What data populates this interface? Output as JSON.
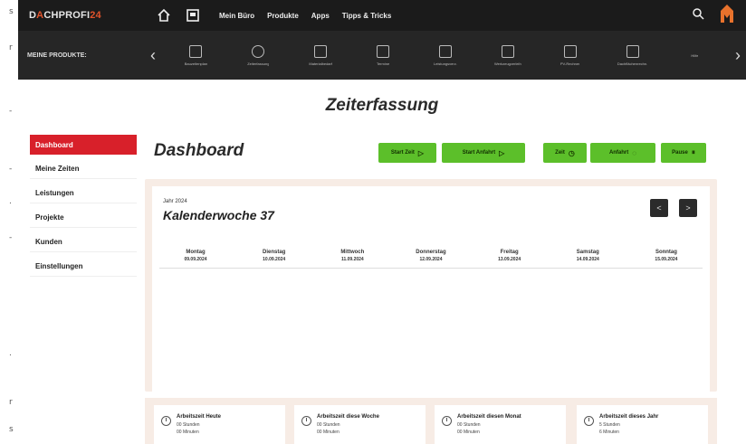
{
  "header": {
    "logo_prefix": "D",
    "logo_accent": "A",
    "logo_rest": "CHPROFI",
    "logo_suffix": "24",
    "nav": [
      "Mein Büro",
      "Produkte",
      "Apps",
      "Tipps & Tricks"
    ]
  },
  "products_bar": {
    "label": "MEINE PRODUKTE:",
    "items": [
      "Bauzeitenplan",
      "Zeiterfassung",
      "Materialbedarf",
      "Termine",
      "Leistungsverz.",
      "Werkzeugverleih",
      "PV-Rechner",
      "Dachflächenrechn.",
      "Hilfe"
    ]
  },
  "page": {
    "title": "Zeiterfassung"
  },
  "sidebar": {
    "items": [
      "Dashboard",
      "Meine Zeiten",
      "Leistungen",
      "Projekte",
      "Kunden",
      "Einstellungen"
    ]
  },
  "dashboard": {
    "title": "Dashboard",
    "buttons": {
      "start_time": "Start Zeit",
      "start_travel": "Start Anfahrt",
      "time": "Zeit",
      "travel": "Anfahrt",
      "pause": "Pause"
    }
  },
  "calendar": {
    "year_label": "Jahr 2024",
    "week_label": "Kalenderwoche 37",
    "prev": "<",
    "next": ">",
    "days": [
      {
        "name": "Montag",
        "date": "09.09.2024"
      },
      {
        "name": "Dienstag",
        "date": "10.09.2024"
      },
      {
        "name": "Mittwoch",
        "date": "11.09.2024"
      },
      {
        "name": "Donnerstag",
        "date": "12.09.2024"
      },
      {
        "name": "Freitag",
        "date": "13.09.2024"
      },
      {
        "name": "Samstag",
        "date": "14.09.2024"
      },
      {
        "name": "Sonntag",
        "date": "15.09.2024"
      }
    ]
  },
  "stats": [
    {
      "title": "Arbeitszeit Heute",
      "line1": "00 Stunden",
      "line2": "00 Minuten"
    },
    {
      "title": "Arbeitszeit diese Woche",
      "line1": "00 Stunden",
      "line2": "00 Minuten"
    },
    {
      "title": "Arbeitszeit diesen Monat",
      "line1": "00 Stunden",
      "line2": "00 Minuten"
    },
    {
      "title": "Arbeitszeit dieses Jahr",
      "line1": "5 Stunden",
      "line2": "6 Minuten"
    }
  ]
}
